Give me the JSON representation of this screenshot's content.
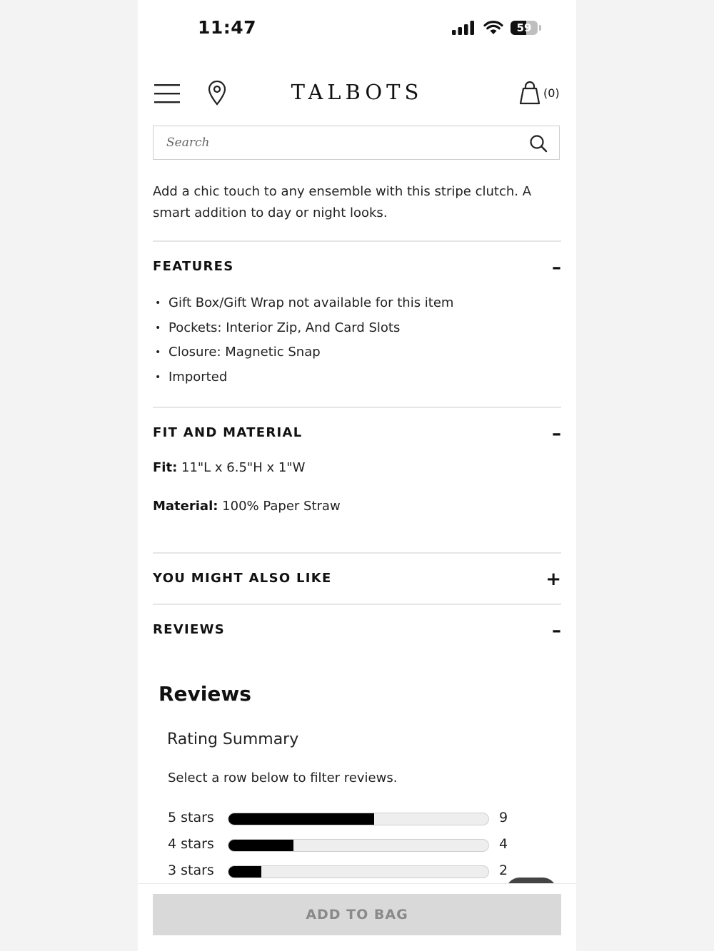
{
  "status_bar": {
    "time": "11:47",
    "battery": "59",
    "battery_level": 0.59
  },
  "header": {
    "logo": "TALBOTS",
    "bag_count": "(0)"
  },
  "search": {
    "placeholder": "Search"
  },
  "description": "Add a chic touch to any ensemble with this stripe clutch. A smart addition to day or night looks.",
  "features": {
    "title": "FEATURES",
    "toggle": "–",
    "items": [
      "Gift Box/Gift Wrap not available for this item",
      "Pockets: Interior Zip, And Card Slots",
      "Closure: Magnetic Snap",
      "Imported"
    ]
  },
  "fit_material": {
    "title": "FIT AND MATERIAL",
    "toggle": "–",
    "fit_label": "Fit:",
    "fit_value": " 11\"L x 6.5\"H x 1\"W",
    "material_label": "Material:",
    "material_value": " 100% Paper Straw"
  },
  "also_like": {
    "title": "YOU MIGHT ALSO LIKE",
    "toggle": "+"
  },
  "reviews_section": {
    "title": "REVIEWS",
    "toggle": "–"
  },
  "reviews": {
    "heading": "Reviews",
    "summary_title": "Rating Summary",
    "filter_hint": "Select a row below to filter reviews.",
    "rows": [
      {
        "label": "5 stars",
        "count": "9",
        "fraction": 0.56
      },
      {
        "label": "4 stars",
        "count": "4",
        "fraction": 0.25
      },
      {
        "label": "3 stars",
        "count": "2",
        "fraction": 0.125
      }
    ]
  },
  "cta": {
    "add_to_bag": "ADD TO BAG"
  },
  "colors": {
    "accent": "#000000",
    "disabled_button": "#d9d9d9",
    "divider": "#e6e6e6"
  }
}
